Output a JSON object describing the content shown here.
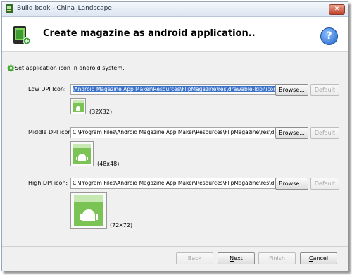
{
  "window": {
    "title": "Build book - China_Landscape",
    "close_glyph": "✕"
  },
  "header": {
    "title": "Create magazine as android application..",
    "help_glyph": "?"
  },
  "section": {
    "label": "Set application icon in android system."
  },
  "rows": [
    {
      "label": "Low DPI Icon:",
      "path": "\\Android Magazine App Maker\\Resources\\FlipMagazine\\res\\drawable-ldpi\\icon.png",
      "browse": "Browse...",
      "default": "Default",
      "size": "(32X32)"
    },
    {
      "label": "Middle DPI icon:",
      "path": "C:\\Program Files\\Android Magazine App Maker\\Resources\\FlipMagazine\\res\\drawa",
      "browse": "Browse...",
      "default": "Default",
      "size": "(48x48)"
    },
    {
      "label": "High DPI icon:",
      "path": "C:\\Program Files\\Android Magazine App Maker\\Resources\\FlipMagazine\\res\\drawa",
      "browse": "Browse...",
      "default": "Default",
      "size": "(72X72)"
    }
  ],
  "footer": {
    "back": "Back",
    "next_accel": "N",
    "next_rest": "ext",
    "finish": "Finish",
    "cancel_accel": "C",
    "cancel_rest": "ancel"
  },
  "icons": {
    "app": "build-book-icon",
    "header": "phone-book-icon",
    "section": "gear-icon",
    "preview": "android-robot-icon"
  }
}
